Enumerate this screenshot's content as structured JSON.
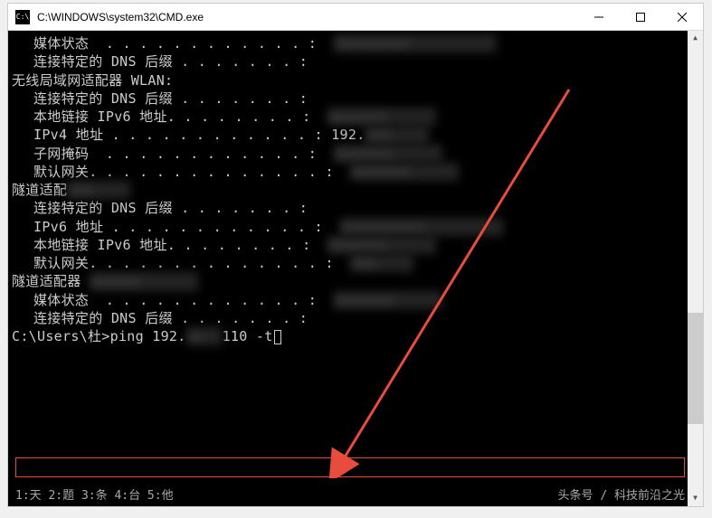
{
  "window": {
    "title": "C:\\WINDOWS\\system32\\CMD.exe"
  },
  "terminal": {
    "blank": "",
    "media_state_label": "媒体状态",
    "dns_suffix_label": "连接特定的 DNS 后缀",
    "adapter_wlan": "无线局域网适配器 WLAN:",
    "ipv6_link_local_label": "本地链接 IPv6 地址.",
    "ipv4_label": "IPv4 地址",
    "ipv4_value": "192.",
    "subnet_label": "子网掩码",
    "gateway_label": "默认网关.",
    "tunnel_adapter_1": "隧道适配",
    "ipv6_label": "IPv6 地址",
    "tunnel_adapter_2": "隧道适配器",
    "prompt_prefix": "C:\\Users\\杜>",
    "prompt_cmd_pre": "ping 192.",
    "prompt_cmd_post": "110 -t",
    "dots_short": " . . . . . . . :",
    "dots_dns": " . . . . . . . :",
    "dots_ipv4": " . . . . . . . . . . . . :",
    "dots_subnet": "  . . . . . . . . . . . . :",
    "dots_gateway": " . . . . . . . . . . . . . :",
    "dots_media": "  . . . . . . . . . . . . :"
  },
  "ime": {
    "options": "1:天  2:题  3:条  4:台  5:他"
  },
  "credit": {
    "text": "头条号 / 科技前沿之光"
  }
}
